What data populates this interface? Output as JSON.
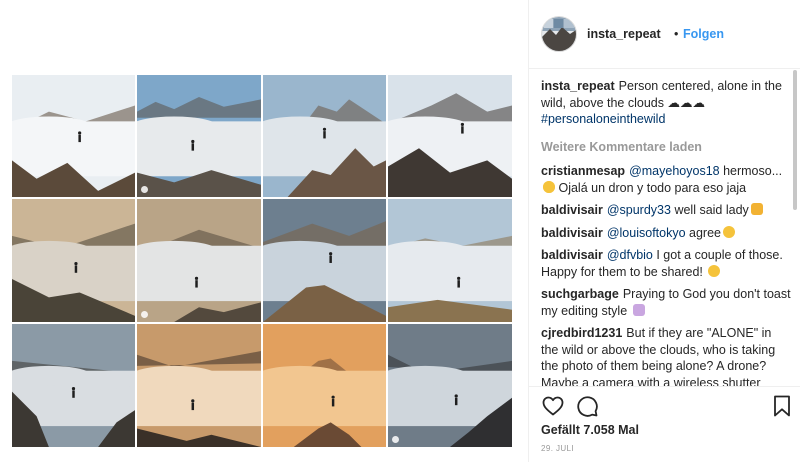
{
  "header": {
    "username": "insta_repeat",
    "separator": "•",
    "follow_label": "Folgen"
  },
  "caption": {
    "user": "insta_repeat",
    "text": "Person centered, alone in the wild, above the clouds ☁☁☁",
    "hashtag": "#personaloneinthewild"
  },
  "load_more_label": "Weitere Kommentare laden",
  "comments": [
    {
      "user": "cristianmesap",
      "mention": "@mayehoyos18",
      "text": " hermoso... ",
      "text2": " Ojalá un dron y todo para eso jaja",
      "emoji": "heart-eyes-emoji"
    },
    {
      "user": "baldivisair",
      "mention": "@spurdy33",
      "text": " well said lady",
      "emoji": "clap-emoji"
    },
    {
      "user": "baldivisair",
      "mention": "@louisoftokyo",
      "text": " agree",
      "emoji": "grin-emoji"
    },
    {
      "user": "baldivisair",
      "mention": "@dfvbio",
      "text": " I got a couple of those. Happy for them to be shared! ",
      "emoji": "smile-emoji"
    },
    {
      "user": "suchgarbage",
      "text": "Praying to God you don't toast my editing style ",
      "emoji": "pray-emoji"
    },
    {
      "user": "cjredbird1231",
      "text": "But if they are \"ALONE\" in the wild or above the clouds, who is taking the photo of them being alone? A drone? Maybe a camera with a wireless shutter controller? Maybe their dog who was"
    }
  ],
  "likes_text": "Gefällt 7.058 Mal",
  "date_text": "29. JULI",
  "icons": {
    "like": "heart-icon",
    "comment": "comment-bubble-icon",
    "save": "bookmark-icon"
  },
  "colors": {
    "link": "#003569",
    "follow": "#3897f0",
    "muted": "#999999",
    "text": "#262626"
  },
  "collage_tiles": [
    {
      "name": "tile-1",
      "sky": "#e9eef2",
      "cloud": "#f4f6f8",
      "rock": "#5b4a3a",
      "has_badge": false
    },
    {
      "name": "tile-2",
      "sky": "#7ea7c9",
      "cloud": "#e7eaec",
      "rock": "#5a5249",
      "has_badge": true
    },
    {
      "name": "tile-3",
      "sky": "#9ab6cd",
      "cloud": "#dfe5ea",
      "rock": "#6a5646",
      "has_badge": false
    },
    {
      "name": "tile-4",
      "sky": "#d9e2ea",
      "cloud": "#eef1f4",
      "rock": "#3f3833",
      "has_badge": false
    },
    {
      "name": "tile-5",
      "sky": "#cbb596",
      "cloud": "#d9d2c7",
      "rock": "#4a4438",
      "has_badge": false
    },
    {
      "name": "tile-6",
      "sky": "#b9a487",
      "cloud": "#e3e4e4",
      "rock": "#53493d",
      "has_badge": true
    },
    {
      "name": "tile-7",
      "sky": "#6d7f8f",
      "cloud": "#c9d3dc",
      "rock": "#7a6145",
      "has_badge": false
    },
    {
      "name": "tile-8",
      "sky": "#b2c6d6",
      "cloud": "#e6eaee",
      "rock": "#8a7350",
      "has_badge": false
    },
    {
      "name": "tile-9",
      "sky": "#8b9aa6",
      "cloud": "#d9dde1",
      "rock": "#3c3833",
      "has_badge": false
    },
    {
      "name": "tile-10",
      "sky": "#c79a6b",
      "cloud": "#f0d9bd",
      "rock": "#3a3028",
      "has_badge": false
    },
    {
      "name": "tile-11",
      "sky": "#e2a05e",
      "cloud": "#f2c690",
      "rock": "#6a4a34",
      "has_badge": false
    },
    {
      "name": "tile-12",
      "sky": "#6f7c88",
      "cloud": "#cfd6dc",
      "rock": "#2f2f31",
      "has_badge": true
    }
  ]
}
